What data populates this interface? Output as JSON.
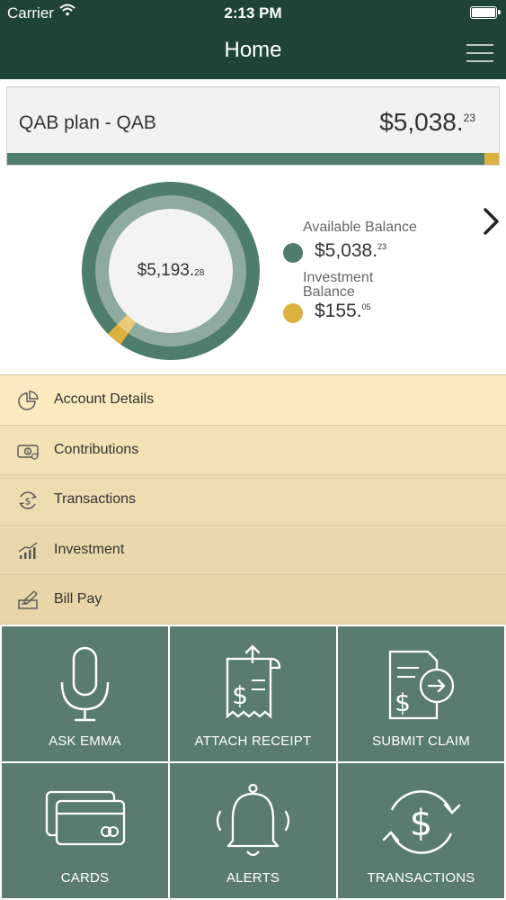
{
  "status_bar": {
    "carrier": "Carrier",
    "time": "2:13 PM"
  },
  "header": {
    "title": "Home"
  },
  "plan": {
    "name": "QAB plan - QAB",
    "amount_main": "$5,038.",
    "amount_cents": "23"
  },
  "balance": {
    "total_main": "$5,193.",
    "total_cents": "28",
    "available": {
      "label": "Available Balance",
      "main": "$5,038.",
      "cents": "23",
      "value": 5038.23,
      "color": "#4f7d6b"
    },
    "investment": {
      "label": "Investment",
      "label2": "Balance",
      "main": "$155.",
      "cents": "05",
      "value": 155.05,
      "color": "#dcb23e"
    }
  },
  "menu": {
    "items": [
      {
        "label": "Account Details",
        "icon": "pie-chart-icon"
      },
      {
        "label": "Contributions",
        "icon": "cash-icon"
      },
      {
        "label": "Transactions",
        "icon": "dollar-cycle-icon"
      },
      {
        "label": "Investment",
        "icon": "growth-chart-icon"
      },
      {
        "label": "Bill Pay",
        "icon": "check-pay-icon"
      }
    ]
  },
  "tiles": {
    "items": [
      {
        "label": "ASK EMMA",
        "icon": "microphone-icon"
      },
      {
        "label": "ATTACH RECEIPT",
        "icon": "receipt-upload-icon"
      },
      {
        "label": "SUBMIT CLAIM",
        "icon": "claim-document-icon"
      },
      {
        "label": "CARDS",
        "icon": "cards-icon"
      },
      {
        "label": "ALERTS",
        "icon": "bell-icon"
      },
      {
        "label": "TRANSACTIONS",
        "icon": "dollar-cycle-icon"
      }
    ]
  },
  "colors": {
    "header": "#1f4434",
    "accent_green": "#4f7d6b",
    "accent_gold": "#dcb23e",
    "tile": "#5a7c6f"
  }
}
